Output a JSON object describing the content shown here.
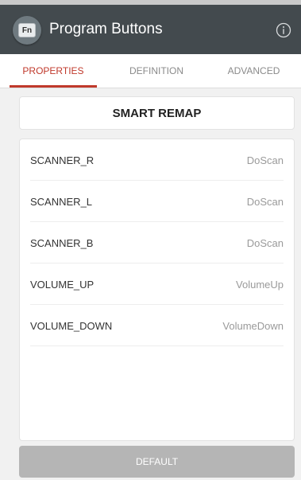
{
  "app": {
    "title": "Program Buttons",
    "icon_text": "Fn"
  },
  "tabs": [
    {
      "label": "PROPERTIES",
      "active": true
    },
    {
      "label": "DEFINITION",
      "active": false
    },
    {
      "label": "ADVANCED",
      "active": false
    }
  ],
  "smart_remap": {
    "label": "SMART REMAP"
  },
  "mappings": [
    {
      "key": "SCANNER_R",
      "value": "DoScan"
    },
    {
      "key": "SCANNER_L",
      "value": "DoScan"
    },
    {
      "key": "SCANNER_B",
      "value": "DoScan"
    },
    {
      "key": "VOLUME_UP",
      "value": "VolumeUp"
    },
    {
      "key": "VOLUME_DOWN",
      "value": "VolumeDown"
    }
  ],
  "default_button": {
    "label": "DEFAULT"
  },
  "colors": {
    "appbar": "#434a4e",
    "accent": "#c0392b",
    "default_button": "#b5b5b5"
  },
  "icons": {
    "app": "fn-key-icon",
    "info": "info-icon"
  }
}
